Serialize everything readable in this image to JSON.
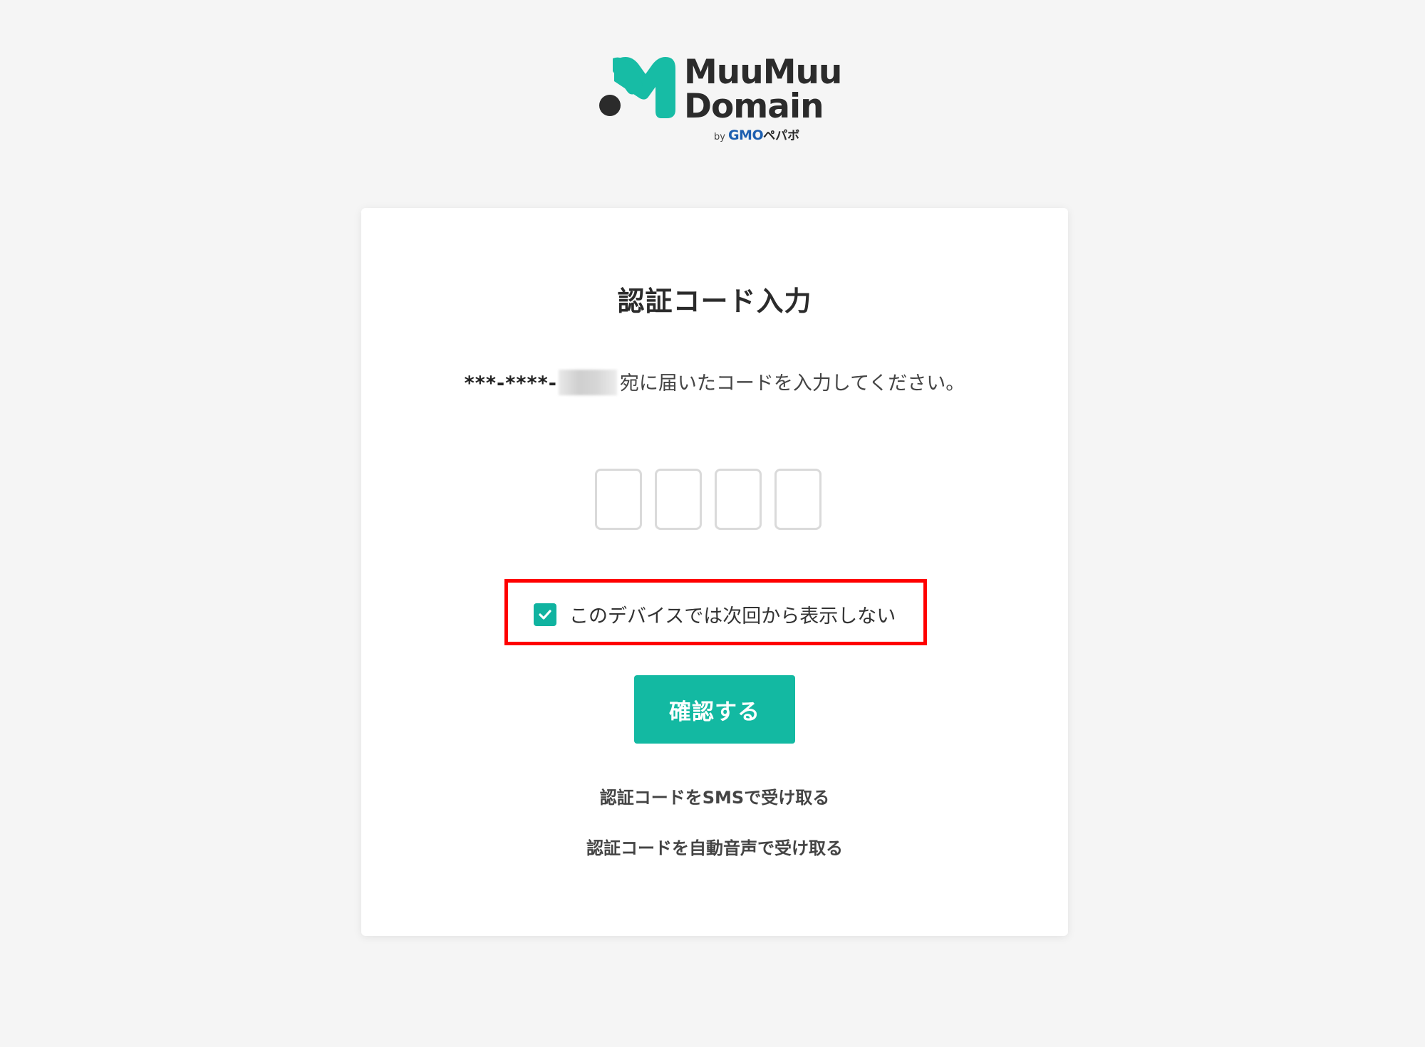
{
  "logo": {
    "line1": "MuuMuu",
    "line2": "Domain",
    "by": "by",
    "gmo": "GMO",
    "pepabo": "ペパボ"
  },
  "card": {
    "title": "認証コード入力",
    "phone_masked": "***-****-",
    "instruction_suffix": "宛に届いたコードを入力してください。",
    "code_digits": [
      "",
      "",
      "",
      ""
    ],
    "remember_label": "このデバイスでは次回から表示しない",
    "remember_checked": true,
    "confirm_label": "確認する",
    "sms_link": "認証コードをSMSで受け取る",
    "voice_link": "認証コードを自動音声で受け取る"
  },
  "colors": {
    "accent": "#13b9a2",
    "highlight_frame": "#ff0000",
    "background": "#f5f5f5"
  }
}
